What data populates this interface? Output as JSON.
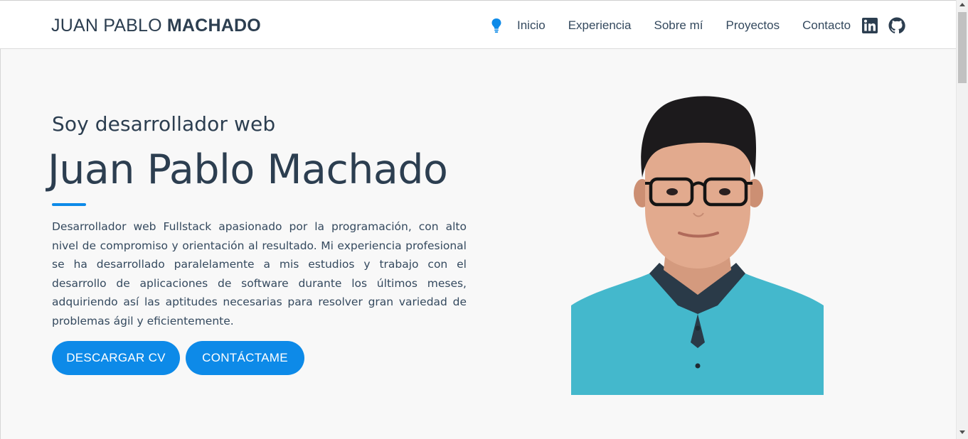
{
  "navbar": {
    "brand_light": "JUAN PABLO ",
    "brand_bold": "MACHADO",
    "links": [
      {
        "label": "Inicio"
      },
      {
        "label": "Experiencia"
      },
      {
        "label": "Sobre mí"
      },
      {
        "label": "Proyectos"
      },
      {
        "label": "Contacto"
      }
    ],
    "icons": [
      "lightbulb-icon",
      "linkedin-icon",
      "github-icon"
    ]
  },
  "hero": {
    "subtitle": "Soy desarrollador web",
    "name": "Juan Pablo Machado",
    "description": "Desarrollador web Fullstack apasionado por la programación, con alto nivel de compromiso y orientación al resultado. Mi experiencia profesional se ha desarrollado paralelamente a mis estudios y trabajo con el desarrollo de aplicaciones de software durante los últimos meses, adquiriendo así las aptitudes necesarias para resolver gran variedad de problemas ágil y eficientemente.",
    "buttons": {
      "cv": "DESCARGAR CV",
      "contact": "CONTÁCTAME"
    }
  },
  "colors": {
    "accent": "#0d8ae8",
    "text": "#2c3e50",
    "background": "#f8f8f8",
    "shirt": "#44b8cc"
  }
}
